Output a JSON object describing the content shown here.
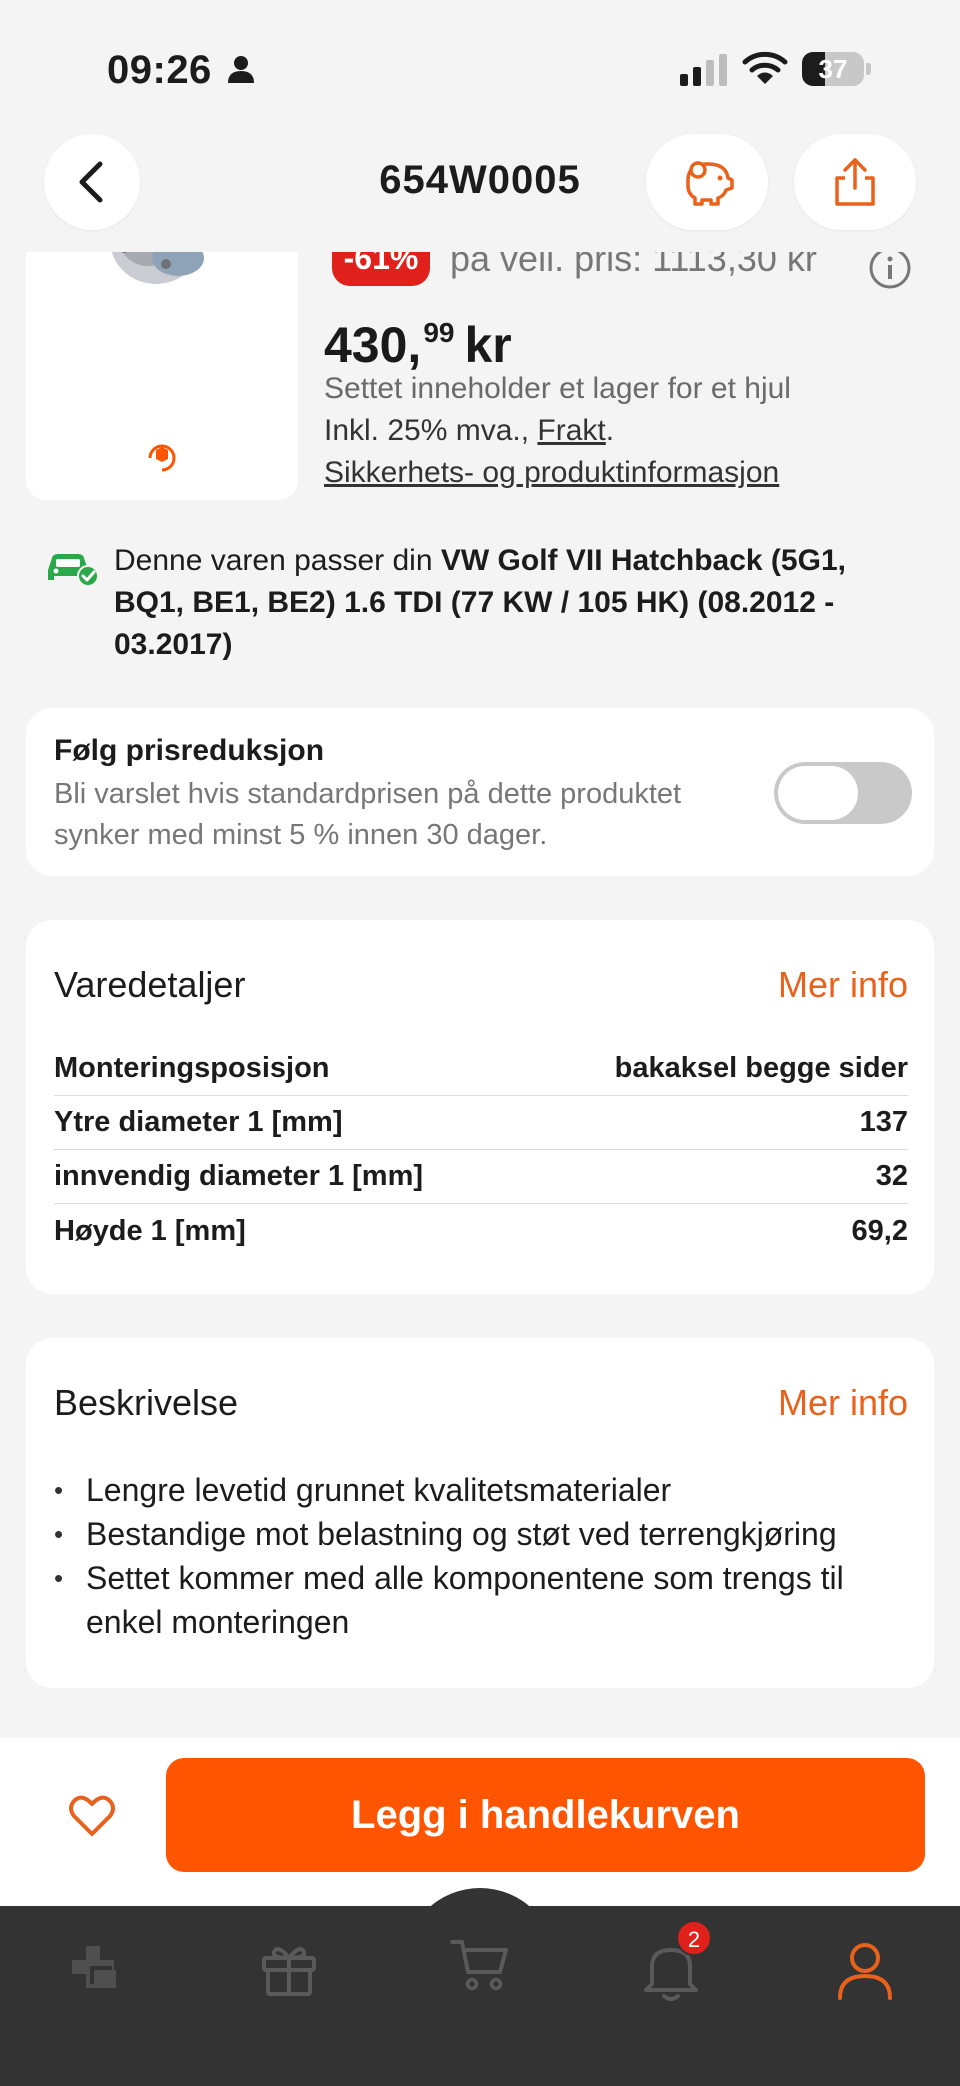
{
  "status_bar": {
    "time": "09:26",
    "battery": "37",
    "battery_level": 0.37
  },
  "header": {
    "title": "654W0005"
  },
  "product": {
    "discount_badge": "-61%",
    "previous_price": "på veil. pris: 1113,30 kr",
    "price_main": "430,",
    "price_cents": "99",
    "price_currency": "kr",
    "set_note": "Settet inneholder et lager for et hjul",
    "vat_text": "Inkl. 25% mva.,",
    "shipping_link": "Frakt",
    "shipping_suffix": ".",
    "safety_link": "Sikkerhets- og produktinformasjon"
  },
  "fit_notice": {
    "prefix": "Denne varen passer din ",
    "vehicle": "VW Golf VII Hatchback (5G1, BQ1, BE1, BE2) 1.6 TDI (77 KW / 105 HK) (08.2012 - 03.2017)"
  },
  "price_alert": {
    "title": "Følg prisreduksjon",
    "description": "Bli varslet hvis standardprisen på dette produktet synker med minst 5 % innen 30 dager.",
    "enabled": false
  },
  "details": {
    "title": "Varedetaljer",
    "more_link": "Mer info",
    "rows": [
      {
        "label": "Monteringsposisjon",
        "value": "bakaksel begge sider"
      },
      {
        "label": "Ytre diameter 1 [mm]",
        "value": "137"
      },
      {
        "label": "innvendig diameter 1 [mm]",
        "value": "32"
      },
      {
        "label": "Høyde 1 [mm]",
        "value": "69,2"
      }
    ]
  },
  "description": {
    "title": "Beskrivelse",
    "more_link": "Mer info",
    "bullets": [
      "Lengre levetid grunnet kvalitetsmaterialer",
      "Bestandige mot belastning og støt ved terrengkjøring",
      "Settet kommer med alle komponentene som trengs til enkel monteringen"
    ]
  },
  "action": {
    "add_to_cart": "Legg i handlekurven"
  },
  "tabbar": {
    "notifications_count": "2"
  },
  "colors": {
    "accent": "#ff5400",
    "link_orange": "#e8621c",
    "badge_red": "#e0201a",
    "fit_green": "#2aa84a",
    "tabbar_bg": "#333333"
  }
}
